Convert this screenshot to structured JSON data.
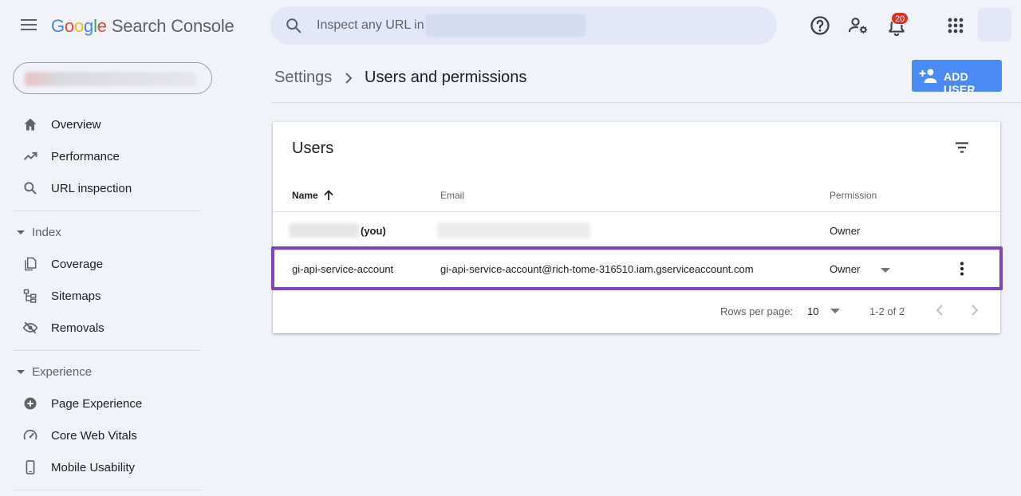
{
  "header": {
    "logo_letters": [
      "G",
      "o",
      "o",
      "g",
      "l",
      "e"
    ],
    "product": "Search Console",
    "search_placeholder": "Inspect any URL in",
    "notification_count": "20"
  },
  "sidebar": {
    "top_items": [
      {
        "label": "Overview",
        "icon": "home-icon"
      },
      {
        "label": "Performance",
        "icon": "trending-up-icon"
      },
      {
        "label": "URL inspection",
        "icon": "search-icon"
      }
    ],
    "sections": [
      {
        "label": "Index",
        "items": [
          {
            "label": "Coverage",
            "icon": "file-copy-icon"
          },
          {
            "label": "Sitemaps",
            "icon": "sitemap-icon"
          },
          {
            "label": "Removals",
            "icon": "visibility-off-icon"
          }
        ]
      },
      {
        "label": "Experience",
        "items": [
          {
            "label": "Page Experience",
            "icon": "add-circle-icon"
          },
          {
            "label": "Core Web Vitals",
            "icon": "speed-gauge-icon"
          },
          {
            "label": "Mobile Usability",
            "icon": "smartphone-icon"
          }
        ]
      }
    ]
  },
  "breadcrumb": {
    "parent": "Settings",
    "current": "Users and permissions"
  },
  "add_user_label": "ADD USER",
  "users_card": {
    "title": "Users",
    "columns": {
      "name": "Name",
      "email": "Email",
      "permission": "Permission"
    },
    "rows": [
      {
        "name_suffix": "(you)",
        "permission": "Owner"
      },
      {
        "name": "gi-api-service-account",
        "email": "gi-api-service-account@rich-tome-316510.iam.gserviceaccount.com",
        "permission": "Owner"
      }
    ],
    "pagination": {
      "rows_per_page_label": "Rows per page:",
      "rows_per_page": "10",
      "range": "1-2 of 2"
    }
  },
  "colors": {
    "accent_blue": "#4a8af4",
    "highlight_purple": "#7e45b8",
    "badge_red": "#d93025",
    "background": "#f1f3fa"
  }
}
